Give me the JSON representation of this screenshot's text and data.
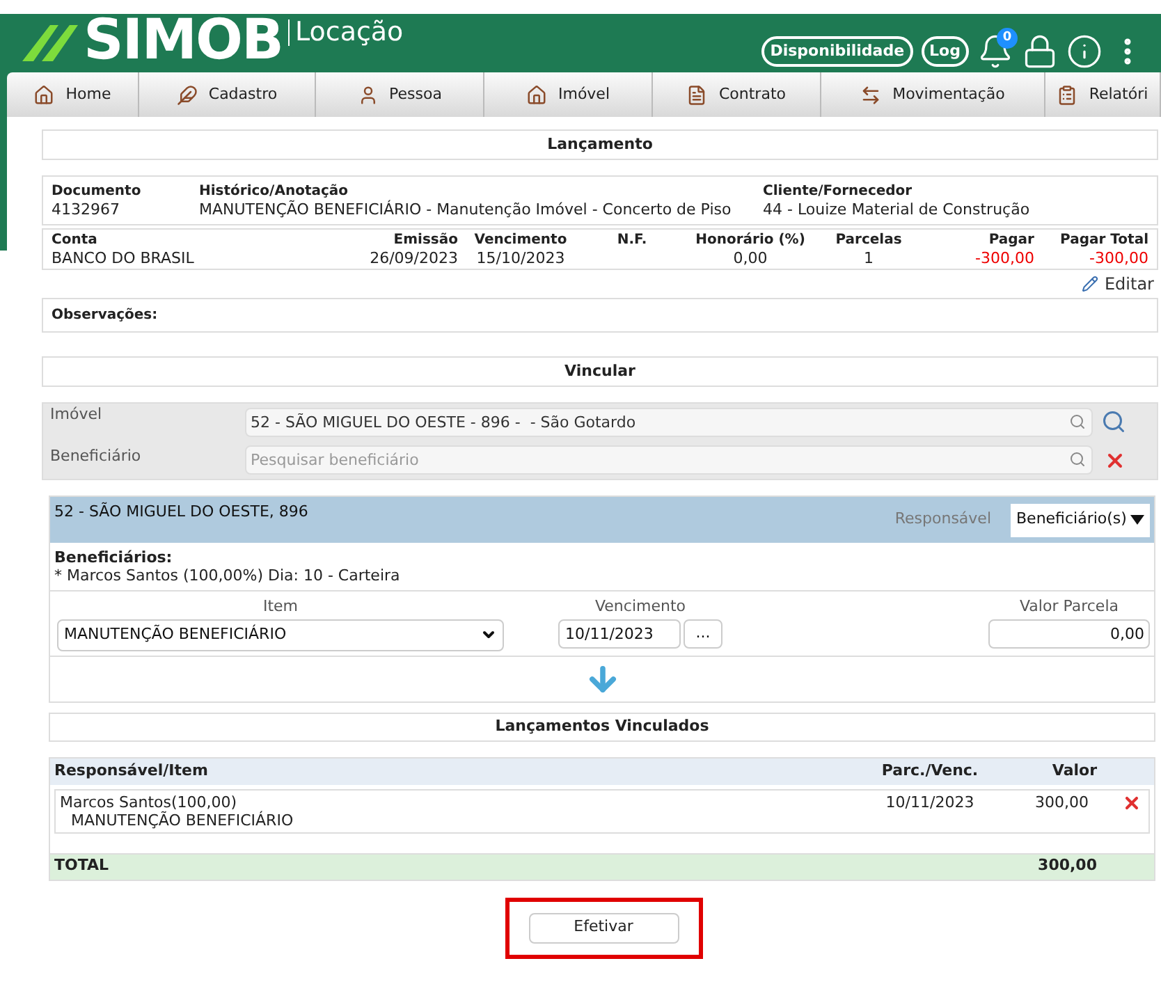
{
  "header": {
    "logo": "SIMOB",
    "subtitle": "Locação",
    "buttons": [
      "Disponibilidade",
      "Log"
    ],
    "notification_count": "0"
  },
  "nav": [
    {
      "label": "Home",
      "kind": "home"
    },
    {
      "label": "Cadastro",
      "kind": "feather"
    },
    {
      "label": "Pessoa",
      "kind": "person"
    },
    {
      "label": "Imóvel",
      "kind": "house"
    },
    {
      "label": "Contrato",
      "kind": "document"
    },
    {
      "label": "Movimentação",
      "kind": "transfer"
    },
    {
      "label": "Relatóri",
      "kind": "clipboard"
    }
  ],
  "lancamento": {
    "title": "Lançamento",
    "info": [
      {
        "label": "Documento",
        "value": "4132967"
      },
      {
        "label": "Histórico/Anotação",
        "value": "MANUTENÇÃO BENEFICIÁRIO - Manutenção Imóvel - Concerto de Piso"
      },
      {
        "label": "Cliente/Fornecedor",
        "value": "44 - Louize Material de Construção"
      }
    ],
    "columns": [
      {
        "label": "Conta",
        "value": "BANCO DO BRASIL",
        "negative": false
      },
      {
        "label": "Emissão",
        "value": "26/09/2023",
        "negative": false
      },
      {
        "label": "Vencimento",
        "value": "15/10/2023",
        "negative": false
      },
      {
        "label": "N.F."
      },
      {
        "label": "Honorário (%)",
        "value": "0,00",
        "negative": false
      },
      {
        "label": "Parcelas",
        "value": "1",
        "negative": false
      },
      {
        "label": "Pagar",
        "value": "-300,00",
        "negative": true
      },
      {
        "label": "Pagar Total",
        "value": "-300,00",
        "negative": true
      }
    ],
    "edit_link": "Editar",
    "observacoes_label": "Observações:"
  },
  "vincular": {
    "title": "Vincular",
    "imovel": {
      "label": "Imóvel",
      "value": "52 - SÃO MIGUEL DO OESTE - 896 -  - São Gotardo"
    },
    "beneficiario": {
      "label": "Beneficiário",
      "placeholder": "Pesquisar beneficiário"
    }
  },
  "property": {
    "title": "52 - SÃO MIGUEL DO OESTE, 896",
    "responsavel_label": "Responsável",
    "responsavel_value": "Beneficiário(s)",
    "beneficiarios_label": "Beneficiários:",
    "beneficiarios_line": "* Marcos Santos (100,00%) Dia: 10 - Carteira",
    "item": {
      "label": "Item",
      "value": "MANUTENÇÃO BENEFICIÁRIO"
    },
    "vencimento": {
      "label": "Vencimento",
      "value": "10/11/2023",
      "button": "..."
    },
    "valor_parcela": {
      "label": "Valor Parcela",
      "value": "0,00"
    }
  },
  "linked": {
    "title": "Lançamentos Vinculados",
    "columns": [
      "Responsável/Item",
      "Parc./Venc.",
      "Valor"
    ],
    "rows": [
      {
        "responsavel": "Marcos Santos(100,00)",
        "item": "MANUTENÇÃO BENEFICIÁRIO",
        "vencimento": "10/11/2023",
        "valor": "300,00"
      }
    ],
    "total_label": "TOTAL",
    "total_value": "300,00"
  },
  "submit": {
    "label": "Efetivar",
    "highlighted": true
  }
}
